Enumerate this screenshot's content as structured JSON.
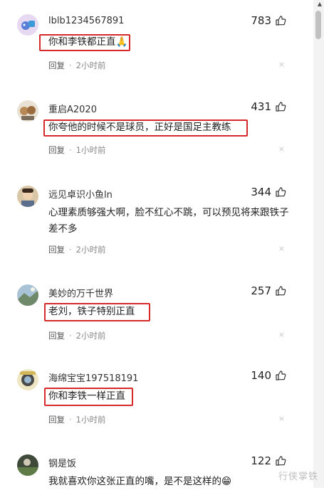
{
  "comments": [
    {
      "username": "lblb1234567891",
      "likes": "783",
      "text": "你和李铁都正直🙏",
      "reply": "回复",
      "time": "2小时前"
    },
    {
      "username": "重启A2020",
      "likes": "431",
      "text": "你夸他的时候不是球员，正好是国足主教练",
      "reply": "回复",
      "time": "1小时前"
    },
    {
      "username": "远见卓识小鱼ln",
      "likes": "344",
      "text": "心理素质够强大啊，脸不红心不跳，可以预见将来跟铁子差不多",
      "reply": "回复",
      "time": "2小时前"
    },
    {
      "username": "美妙的万千世界",
      "likes": "257",
      "text": "老刘，铁子特别正直",
      "reply": "回复",
      "time": "2小时前"
    },
    {
      "username": "海绵宝宝197518191",
      "likes": "140",
      "text": "你和李铁一样正直",
      "reply": "回复",
      "time": "1小时前"
    },
    {
      "username": "钢是饭",
      "likes": "122",
      "text": "我就喜欢你这张正直的嘴，是不是这样的😁",
      "reply": "",
      "time": ""
    }
  ],
  "dismiss_icon": "×",
  "watermark": "行侠掌铁",
  "colors": {
    "highlight": "#d62a2a"
  }
}
